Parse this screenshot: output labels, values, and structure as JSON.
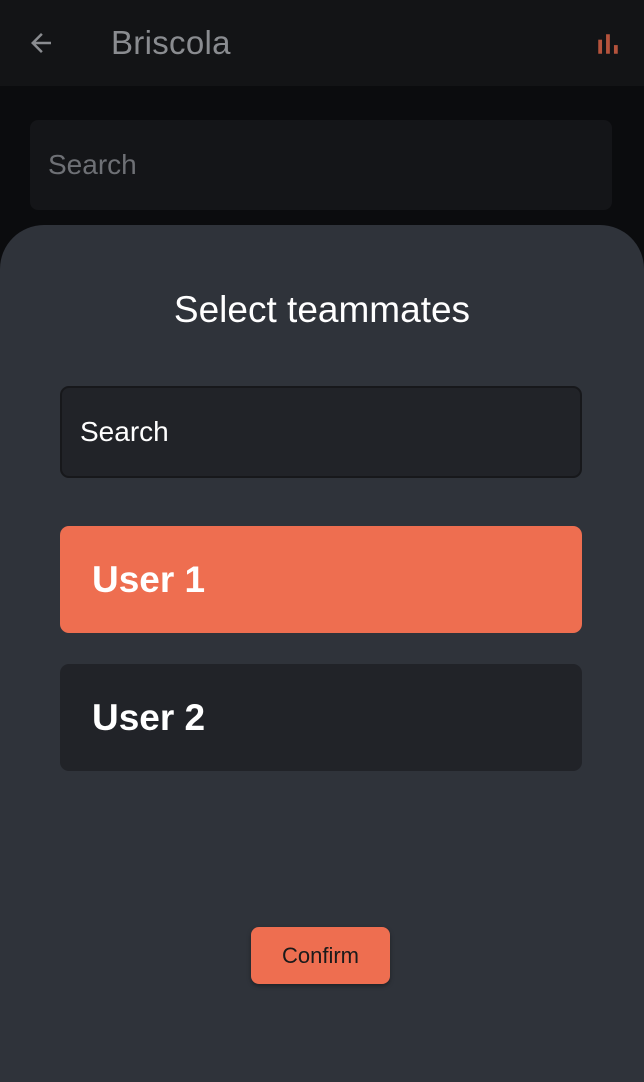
{
  "appbar": {
    "back_icon": "arrow-left-icon",
    "title": "Briscola",
    "stats_icon": "bar-chart-icon",
    "accent_color": "#b5533c"
  },
  "background": {
    "search_placeholder": "Search"
  },
  "sheet": {
    "title": "Select teammates",
    "search_placeholder": "Search",
    "users": [
      {
        "name": "User 1",
        "selected": true
      },
      {
        "name": "User 2",
        "selected": false
      }
    ],
    "confirm_label": "Confirm",
    "colors": {
      "accent": "#ee6e50",
      "sheet_bg": "#2f333a",
      "item_bg": "#212328"
    }
  }
}
